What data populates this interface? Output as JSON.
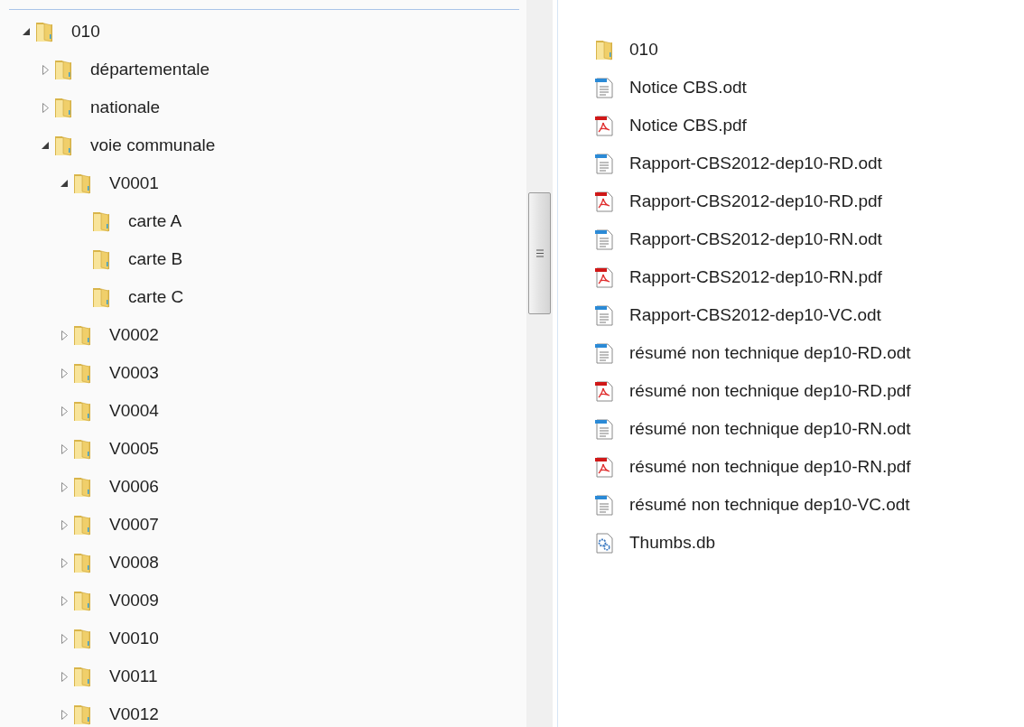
{
  "tree": [
    {
      "label": "010",
      "expanded": true,
      "children": [
        {
          "label": "départementale",
          "expanded": false
        },
        {
          "label": "nationale",
          "expanded": false
        },
        {
          "label": "voie communale",
          "expanded": true,
          "children": [
            {
              "label": "V0001",
              "expanded": true,
              "children": [
                {
                  "label": "carte A"
                },
                {
                  "label": "carte B"
                },
                {
                  "label": "carte C"
                }
              ]
            },
            {
              "label": "V0002",
              "expanded": false
            },
            {
              "label": "V0003",
              "expanded": false
            },
            {
              "label": "V0004",
              "expanded": false
            },
            {
              "label": "V0005",
              "expanded": false
            },
            {
              "label": "V0006",
              "expanded": false
            },
            {
              "label": "V0007",
              "expanded": false
            },
            {
              "label": "V0008",
              "expanded": false
            },
            {
              "label": "V0009",
              "expanded": false
            },
            {
              "label": "V0010",
              "expanded": false
            },
            {
              "label": "V0011",
              "expanded": false
            },
            {
              "label": "V0012",
              "expanded": false
            }
          ]
        }
      ]
    }
  ],
  "files": [
    {
      "name": "010",
      "kind": "folder"
    },
    {
      "name": "Notice CBS.odt",
      "kind": "odt"
    },
    {
      "name": "Notice CBS.pdf",
      "kind": "pdf"
    },
    {
      "name": "Rapport-CBS2012-dep10-RD.odt",
      "kind": "odt"
    },
    {
      "name": "Rapport-CBS2012-dep10-RD.pdf",
      "kind": "pdf"
    },
    {
      "name": "Rapport-CBS2012-dep10-RN.odt",
      "kind": "odt"
    },
    {
      "name": "Rapport-CBS2012-dep10-RN.pdf",
      "kind": "pdf"
    },
    {
      "name": "Rapport-CBS2012-dep10-VC.odt",
      "kind": "odt"
    },
    {
      "name": "résumé non technique dep10-RD.odt",
      "kind": "odt"
    },
    {
      "name": "résumé non technique dep10-RD.pdf",
      "kind": "pdf"
    },
    {
      "name": "résumé non technique dep10-RN.odt",
      "kind": "odt"
    },
    {
      "name": "résumé non technique dep10-RN.pdf",
      "kind": "pdf"
    },
    {
      "name": "résumé non technique dep10-VC.odt",
      "kind": "odt"
    },
    {
      "name": "Thumbs.db",
      "kind": "db"
    }
  ]
}
